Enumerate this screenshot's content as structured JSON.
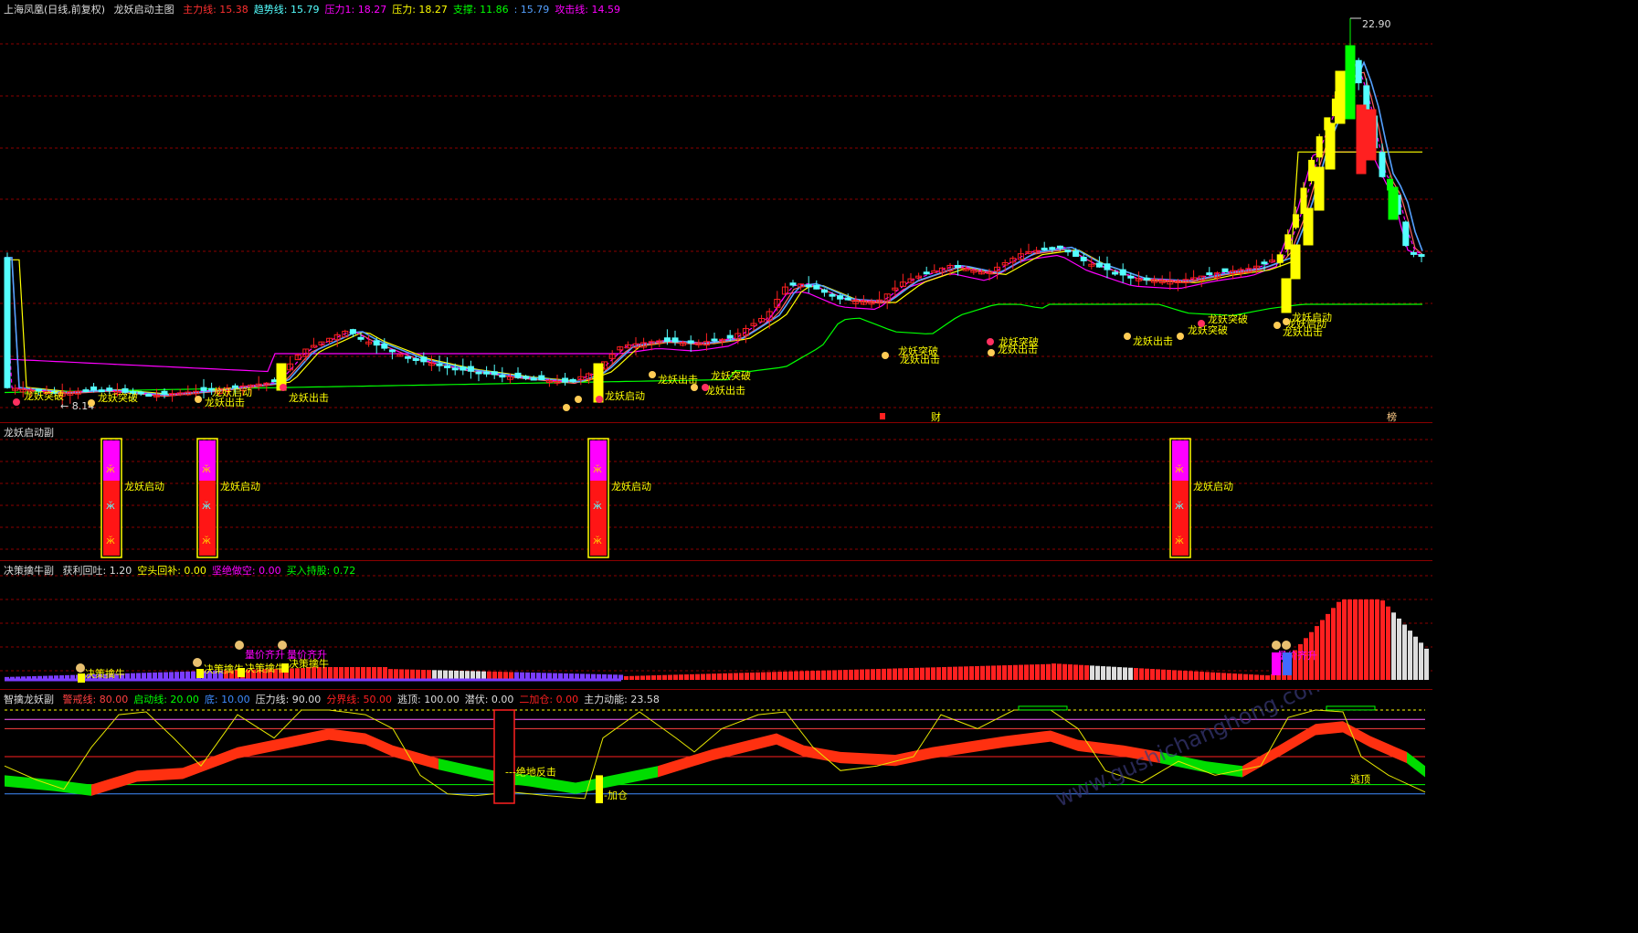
{
  "colors": {
    "up": "#ff2020",
    "down": "#00ff00",
    "cyan": "#54ffff",
    "yellow": "#ffff00",
    "magenta": "#ff00ff",
    "grid": "#8b0000",
    "purple": "#7b3cff",
    "white": "#dddddd"
  },
  "main": {
    "symbol": "上海凤凰(日线,前复权)",
    "indicator": "龙妖启动主图",
    "values": [
      {
        "name": "主力线:",
        "value": "15.38",
        "color": "#ff3030"
      },
      {
        "name": "趋势线:",
        "value": "15.79",
        "color": "#54ffff"
      },
      {
        "name": "压力1:",
        "value": "18.27",
        "color": "#ff00ff"
      },
      {
        "name": "压力:",
        "value": "18.27",
        "color": "#ffff00"
      },
      {
        "name": "支撑:",
        "value": "11.86",
        "color": "#00ff00"
      },
      {
        "name": ":",
        "value": "15.79",
        "color": "#54a0ff"
      },
      {
        "name": "攻击线:",
        "value": "14.59",
        "color": "#ff00ff"
      }
    ],
    "high_label": "22.90",
    "low_label": "8.14",
    "signals": [
      "龙妖突破",
      "龙妖突破",
      "龙妖启动",
      "龙妖出击",
      "龙妖出击",
      "龙妖启动",
      "龙妖出击",
      "龙妖突破",
      "龙妖出击",
      "龙妖突破",
      "龙妖出击",
      "龙妖突破",
      "龙妖出击",
      "龙妖出击",
      "龙妖突破",
      "龙妖突破",
      "龙妖启动",
      "龙妖启动",
      "龙妖出击"
    ],
    "markers": [
      "财",
      "榜"
    ]
  },
  "sub1": {
    "title": "龙妖启动副",
    "label": "龙妖启动"
  },
  "sub2": {
    "title": "决策擒牛副",
    "values": [
      {
        "name": "获利回吐:",
        "value": "1.20",
        "color": "#dddddd"
      },
      {
        "name": "空头回补:",
        "value": "0.00",
        "color": "#ffff00"
      },
      {
        "name": "坚绝做空:",
        "value": "0.00",
        "color": "#ff00ff"
      },
      {
        "name": "买入持股:",
        "value": "0.72",
        "color": "#00ff00"
      }
    ],
    "signals": [
      "决策擒牛",
      "决策擒牛",
      "决策擒牛",
      "决策擒牛"
    ],
    "signals2": [
      "量价齐升",
      "量价齐升",
      "量价齐升"
    ]
  },
  "sub3": {
    "title": "智擒龙妖副",
    "values": [
      {
        "name": "警戒线:",
        "value": "80.00",
        "color": "#ff4040"
      },
      {
        "name": "启动线:",
        "value": "20.00",
        "color": "#00ff00"
      },
      {
        "name": "底:",
        "value": "10.00",
        "color": "#3f8cff"
      },
      {
        "name": "压力线:",
        "value": "90.00",
        "color": "#dddddd"
      },
      {
        "name": "分界线:",
        "value": "50.00",
        "color": "#ff2020"
      },
      {
        "name": "逃顶:",
        "value": "100.00",
        "color": "#dddddd"
      },
      {
        "name": "潜伏:",
        "value": "0.00",
        "color": "#dddddd"
      },
      {
        "name": "二加仓:",
        "value": "0.00",
        "color": "#ff2020"
      },
      {
        "name": "主力动能:",
        "value": "23.58",
        "color": "#dddddd"
      }
    ],
    "label_jd": "绝地反击",
    "label_jc": "加仓",
    "label_td": "逃顶"
  },
  "watermark": "www.gushichanghong.com"
}
